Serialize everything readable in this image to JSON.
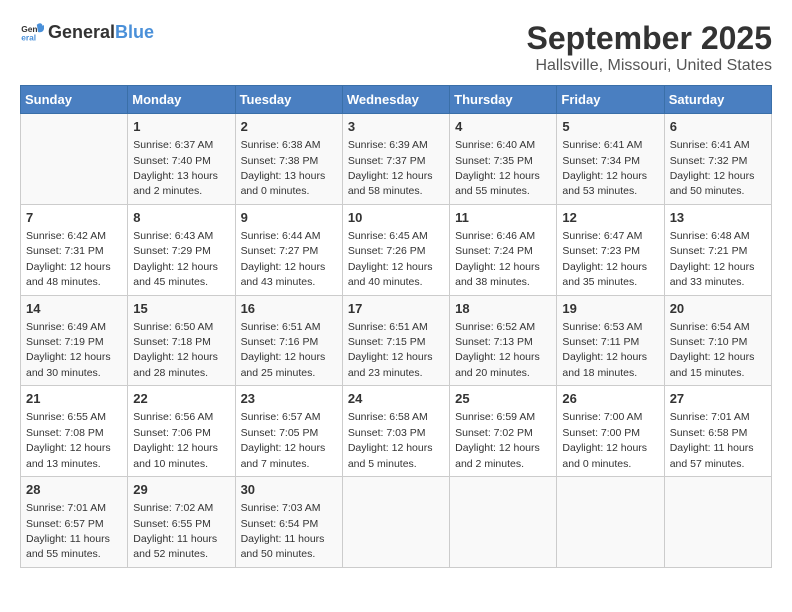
{
  "logo": {
    "text_general": "General",
    "text_blue": "Blue"
  },
  "header": {
    "month": "September 2025",
    "location": "Hallsville, Missouri, United States"
  },
  "weekdays": [
    "Sunday",
    "Monday",
    "Tuesday",
    "Wednesday",
    "Thursday",
    "Friday",
    "Saturday"
  ],
  "weeks": [
    [
      {
        "day": null,
        "info": null
      },
      {
        "day": "1",
        "info": "Sunrise: 6:37 AM\nSunset: 7:40 PM\nDaylight: 13 hours\nand 2 minutes."
      },
      {
        "day": "2",
        "info": "Sunrise: 6:38 AM\nSunset: 7:38 PM\nDaylight: 13 hours\nand 0 minutes."
      },
      {
        "day": "3",
        "info": "Sunrise: 6:39 AM\nSunset: 7:37 PM\nDaylight: 12 hours\nand 58 minutes."
      },
      {
        "day": "4",
        "info": "Sunrise: 6:40 AM\nSunset: 7:35 PM\nDaylight: 12 hours\nand 55 minutes."
      },
      {
        "day": "5",
        "info": "Sunrise: 6:41 AM\nSunset: 7:34 PM\nDaylight: 12 hours\nand 53 minutes."
      },
      {
        "day": "6",
        "info": "Sunrise: 6:41 AM\nSunset: 7:32 PM\nDaylight: 12 hours\nand 50 minutes."
      }
    ],
    [
      {
        "day": "7",
        "info": "Sunrise: 6:42 AM\nSunset: 7:31 PM\nDaylight: 12 hours\nand 48 minutes."
      },
      {
        "day": "8",
        "info": "Sunrise: 6:43 AM\nSunset: 7:29 PM\nDaylight: 12 hours\nand 45 minutes."
      },
      {
        "day": "9",
        "info": "Sunrise: 6:44 AM\nSunset: 7:27 PM\nDaylight: 12 hours\nand 43 minutes."
      },
      {
        "day": "10",
        "info": "Sunrise: 6:45 AM\nSunset: 7:26 PM\nDaylight: 12 hours\nand 40 minutes."
      },
      {
        "day": "11",
        "info": "Sunrise: 6:46 AM\nSunset: 7:24 PM\nDaylight: 12 hours\nand 38 minutes."
      },
      {
        "day": "12",
        "info": "Sunrise: 6:47 AM\nSunset: 7:23 PM\nDaylight: 12 hours\nand 35 minutes."
      },
      {
        "day": "13",
        "info": "Sunrise: 6:48 AM\nSunset: 7:21 PM\nDaylight: 12 hours\nand 33 minutes."
      }
    ],
    [
      {
        "day": "14",
        "info": "Sunrise: 6:49 AM\nSunset: 7:19 PM\nDaylight: 12 hours\nand 30 minutes."
      },
      {
        "day": "15",
        "info": "Sunrise: 6:50 AM\nSunset: 7:18 PM\nDaylight: 12 hours\nand 28 minutes."
      },
      {
        "day": "16",
        "info": "Sunrise: 6:51 AM\nSunset: 7:16 PM\nDaylight: 12 hours\nand 25 minutes."
      },
      {
        "day": "17",
        "info": "Sunrise: 6:51 AM\nSunset: 7:15 PM\nDaylight: 12 hours\nand 23 minutes."
      },
      {
        "day": "18",
        "info": "Sunrise: 6:52 AM\nSunset: 7:13 PM\nDaylight: 12 hours\nand 20 minutes."
      },
      {
        "day": "19",
        "info": "Sunrise: 6:53 AM\nSunset: 7:11 PM\nDaylight: 12 hours\nand 18 minutes."
      },
      {
        "day": "20",
        "info": "Sunrise: 6:54 AM\nSunset: 7:10 PM\nDaylight: 12 hours\nand 15 minutes."
      }
    ],
    [
      {
        "day": "21",
        "info": "Sunrise: 6:55 AM\nSunset: 7:08 PM\nDaylight: 12 hours\nand 13 minutes."
      },
      {
        "day": "22",
        "info": "Sunrise: 6:56 AM\nSunset: 7:06 PM\nDaylight: 12 hours\nand 10 minutes."
      },
      {
        "day": "23",
        "info": "Sunrise: 6:57 AM\nSunset: 7:05 PM\nDaylight: 12 hours\nand 7 minutes."
      },
      {
        "day": "24",
        "info": "Sunrise: 6:58 AM\nSunset: 7:03 PM\nDaylight: 12 hours\nand 5 minutes."
      },
      {
        "day": "25",
        "info": "Sunrise: 6:59 AM\nSunset: 7:02 PM\nDaylight: 12 hours\nand 2 minutes."
      },
      {
        "day": "26",
        "info": "Sunrise: 7:00 AM\nSunset: 7:00 PM\nDaylight: 12 hours\nand 0 minutes."
      },
      {
        "day": "27",
        "info": "Sunrise: 7:01 AM\nSunset: 6:58 PM\nDaylight: 11 hours\nand 57 minutes."
      }
    ],
    [
      {
        "day": "28",
        "info": "Sunrise: 7:01 AM\nSunset: 6:57 PM\nDaylight: 11 hours\nand 55 minutes."
      },
      {
        "day": "29",
        "info": "Sunrise: 7:02 AM\nSunset: 6:55 PM\nDaylight: 11 hours\nand 52 minutes."
      },
      {
        "day": "30",
        "info": "Sunrise: 7:03 AM\nSunset: 6:54 PM\nDaylight: 11 hours\nand 50 minutes."
      },
      {
        "day": null,
        "info": null
      },
      {
        "day": null,
        "info": null
      },
      {
        "day": null,
        "info": null
      },
      {
        "day": null,
        "info": null
      }
    ]
  ]
}
